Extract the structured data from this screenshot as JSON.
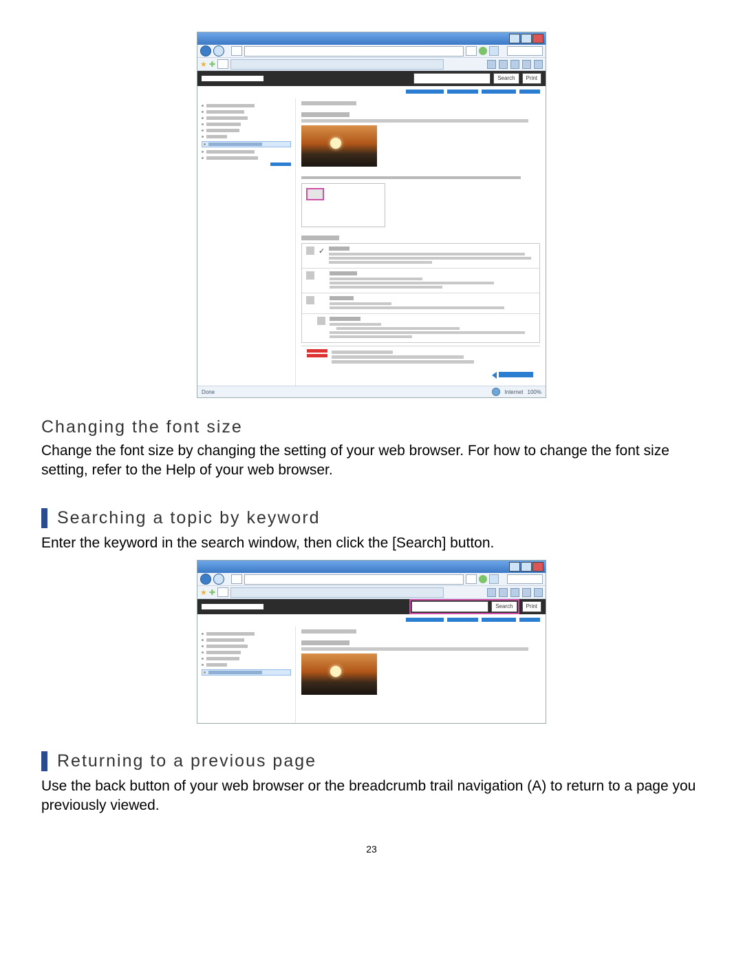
{
  "page_number": "23",
  "sections": {
    "font_size": {
      "heading": "Changing the font size",
      "body": "Change the font size by changing the setting of your web browser. For how to change the font size setting, refer to the Help of your web browser."
    },
    "search": {
      "heading": "Searching a topic by keyword",
      "body": "Enter the keyword in the search window, then click the [Search] button."
    },
    "return": {
      "heading": "Returning to a previous page",
      "body": "Use the back button of your web browser or the breadcrumb trail navigation (A) to return to a page you previously viewed."
    }
  },
  "browser": {
    "buttons": {
      "search": "Search",
      "print": "Print"
    },
    "status": {
      "done": "Done",
      "internet": "Internet",
      "zoom": "100%"
    }
  }
}
